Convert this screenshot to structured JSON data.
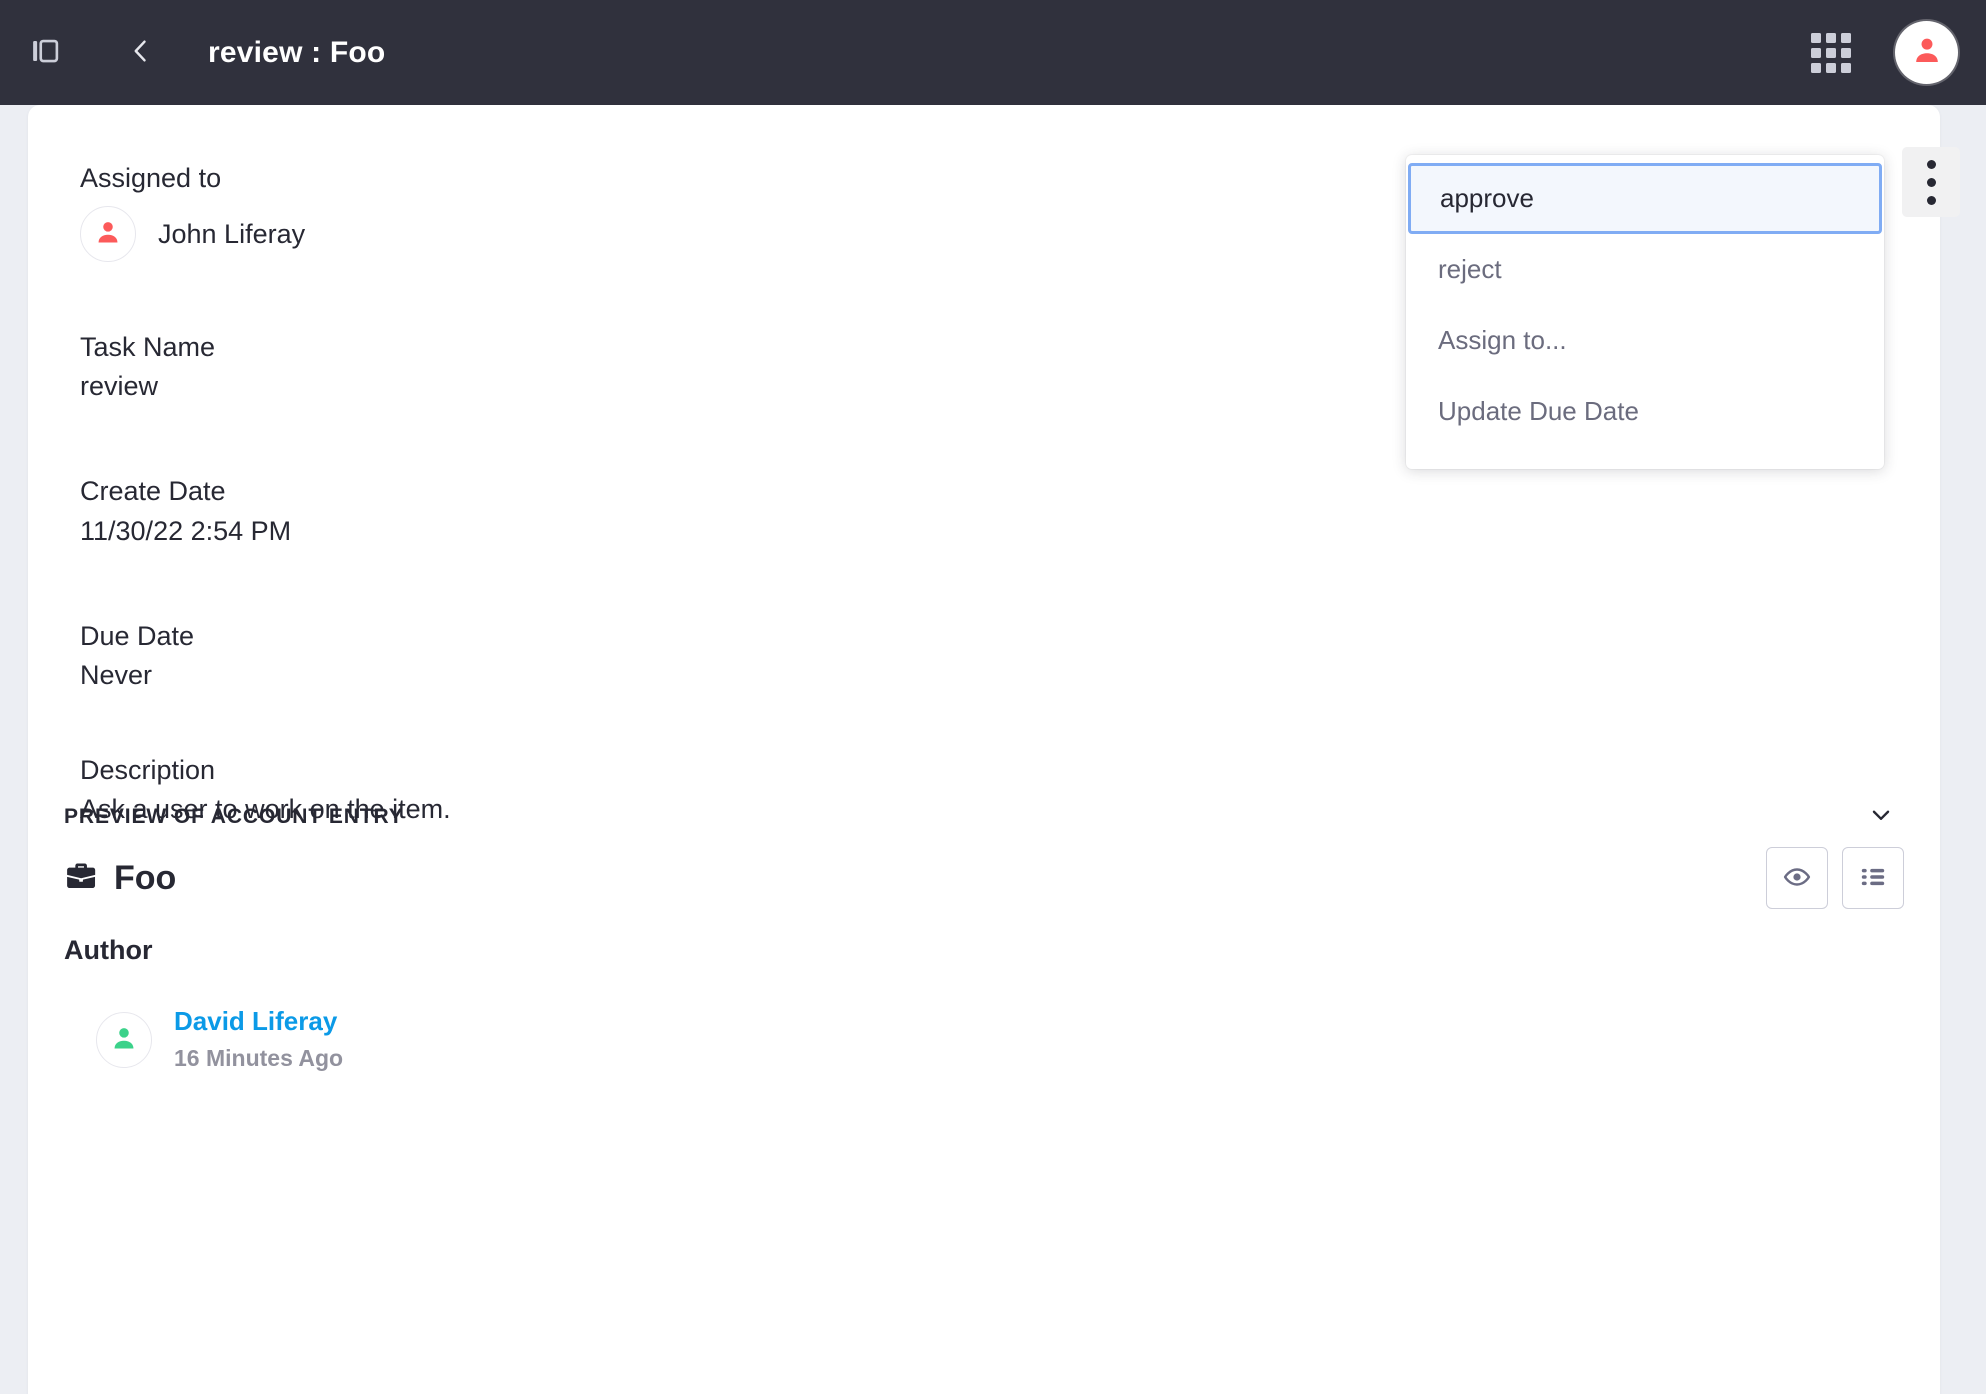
{
  "topbar": {
    "sidebar_toggle_icon": "sidebar-panel-icon",
    "back_icon": "chevron-left-icon",
    "title": "review : Foo",
    "apps_icon": "grid-apps-icon",
    "avatar_icon": "user-avatar-icon",
    "bg_color": "#30313d"
  },
  "task": {
    "assigned_to_label": "Assigned to",
    "assignee_name": "John Liferay",
    "assignee_avatar_icon": "user-icon",
    "assignee_avatar_color": "#fc5a5a",
    "task_name_label": "Task Name",
    "task_name_value": "review",
    "create_date_label": "Create Date",
    "create_date_value": "11/30/22 2:54 PM",
    "due_date_label": "Due Date",
    "due_date_value": "Never",
    "description_label": "Description",
    "description_value": "Ask a user to work on the item."
  },
  "dropdown": {
    "kebab_icon": "kebab-vertical-icon",
    "active_color": "#80acf4",
    "items": [
      {
        "label": "approve",
        "active": true
      },
      {
        "label": "reject",
        "active": false
      },
      {
        "label": "Assign to...",
        "active": false
      },
      {
        "label": "Update Due Date",
        "active": false
      }
    ]
  },
  "preview": {
    "section_title": "PREVIEW OF ACCOUNT ENTRY",
    "collapse_icon": "chevron-down-icon",
    "entry_icon": "briefcase-icon",
    "entry_title": "Foo",
    "actions": [
      {
        "icon": "eye-icon",
        "name": "preview-button"
      },
      {
        "icon": "list-icon",
        "name": "list-view-button"
      }
    ],
    "author_heading": "Author",
    "author_name": "David Liferay",
    "author_link_color": "#0b9ae7",
    "author_time": "16 Minutes Ago",
    "author_avatar_icon": "user-icon",
    "author_avatar_color": "#3bd28a"
  }
}
